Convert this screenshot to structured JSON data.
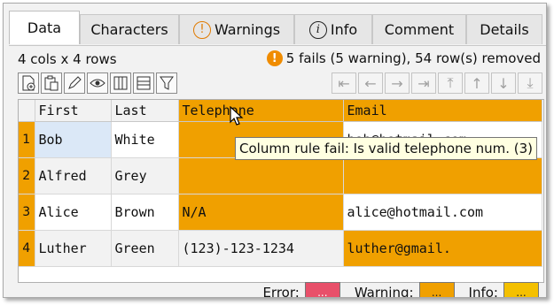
{
  "tabs": [
    {
      "label": "Data",
      "icon": ""
    },
    {
      "label": "Characters",
      "icon": ""
    },
    {
      "label": "Warnings",
      "icon": "warning-circle-icon",
      "glyph": "!"
    },
    {
      "label": "Info",
      "icon": "info-circle-icon",
      "glyph": "i"
    },
    {
      "label": "Comment",
      "icon": ""
    },
    {
      "label": "Details",
      "icon": ""
    }
  ],
  "summary": {
    "shape": "4 cols x 4 rows",
    "status_glyph": "!",
    "status": "5 fails (5 warning), 54 row(s) removed"
  },
  "toolbar": {
    "icons": [
      "add-file-icon",
      "paste-icon",
      "edit-pencil-icon",
      "view-eye-icon",
      "columns-icon",
      "rows-icon",
      "filter-icon"
    ],
    "nav_icons": [
      "first-column-icon",
      "previous-column-icon",
      "next-column-icon",
      "last-column-icon",
      "first-row-icon",
      "previous-row-icon",
      "next-row-icon",
      "last-row-icon"
    ],
    "nav_glyphs": [
      "⇤",
      "←",
      "→",
      "⇥",
      "⤒",
      "↑",
      "↓",
      "⤓"
    ]
  },
  "grid": {
    "columns": [
      "First",
      "Last",
      "Telephone",
      "Email"
    ],
    "rows": [
      {
        "n": "1",
        "cells": [
          "Bob",
          "White",
          "",
          "bob@hotmail.com"
        ]
      },
      {
        "n": "2",
        "cells": [
          "Alfred",
          "Grey",
          "",
          ""
        ]
      },
      {
        "n": "3",
        "cells": [
          "Alice",
          "Brown",
          "N/A",
          "alice@hotmail.com"
        ]
      },
      {
        "n": "4",
        "cells": [
          "Luther",
          "Green",
          "(123)-123-1234",
          "luther@gmail."
        ]
      }
    ]
  },
  "tooltip": "Column rule fail: Is valid telephone num. (3)",
  "legend": {
    "error_label": "Error:",
    "warning_label": "Warning:",
    "info_label": "Info:",
    "button_text": "...",
    "colors": {
      "error": "#e8506a",
      "warning": "#f0a000",
      "info": "#f4c000",
      "fail": "#f0a000"
    }
  }
}
